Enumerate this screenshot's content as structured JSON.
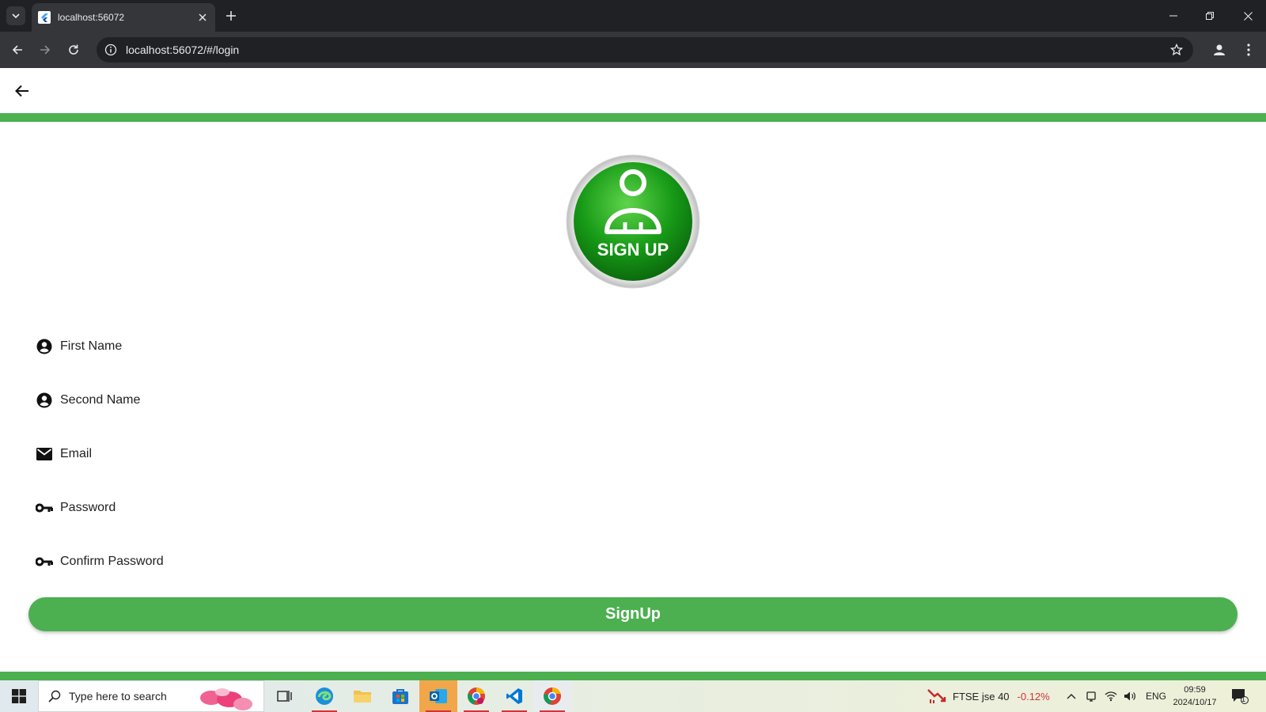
{
  "browser": {
    "tab_title": "localhost:56072",
    "url": "localhost:56072/#/login"
  },
  "page": {
    "logo_text": "SIGN UP",
    "fields": [
      {
        "placeholder": "First Name",
        "icon": "account-circle-icon"
      },
      {
        "placeholder": "Second Name",
        "icon": "account-circle-icon"
      },
      {
        "placeholder": "Email",
        "icon": "mail-icon"
      },
      {
        "placeholder": "Password",
        "icon": "key-icon"
      },
      {
        "placeholder": "Confirm Password",
        "icon": "key-icon"
      }
    ],
    "submit_label": "SignUp"
  },
  "taskbar": {
    "search_placeholder": "Type here to search",
    "ticker_name": "FTSE jse 40",
    "ticker_change": "-0.12%",
    "language": "ENG",
    "time": "09:59",
    "date": "2024/10/17",
    "notification_count": "1"
  },
  "colors": {
    "accent": "#4caf50",
    "chrome_dark": "#202124",
    "chrome_toolbar": "#35363a",
    "ticker_negative": "#d13438"
  }
}
